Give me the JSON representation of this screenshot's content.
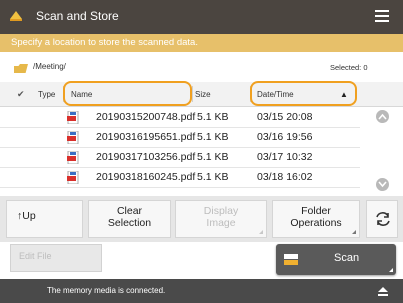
{
  "app": {
    "title": "Scan and Store"
  },
  "instruction": "Specify a location to store the scanned data.",
  "location": {
    "path": "/Meeting/",
    "selected": "Selected: 0"
  },
  "columns": {
    "check": "✔",
    "type": "Type",
    "name": "Name",
    "size": "Size",
    "date": "Date/Time",
    "sort_indicator": "▲"
  },
  "files": [
    {
      "name": "20190315200748.pdf",
      "size": "5.1 KB",
      "date": "03/15  20:08"
    },
    {
      "name": "20190316195651.pdf",
      "size": "5.1 KB",
      "date": "03/16  19:56"
    },
    {
      "name": "20190317103256.pdf",
      "size": "5.1 KB",
      "date": "03/17  10:32"
    },
    {
      "name": "20190318160245.pdf",
      "size": "5.1 KB",
      "date": "03/18  16:02"
    }
  ],
  "toolbar": {
    "up": "Up",
    "clear_line1": "Clear",
    "clear_line2": "Selection",
    "display_line1": "Display",
    "display_line2": "Image",
    "folder_line1": "Folder",
    "folder_line2": "Operations"
  },
  "edit_file": "Edit File",
  "scan": "Scan",
  "status": "The memory media is connected.",
  "colors": {
    "header_bg": "#4b4540",
    "instruction_bg": "#e7c06a",
    "highlight": "#f0a020",
    "pdf_red": "#d9302c"
  }
}
